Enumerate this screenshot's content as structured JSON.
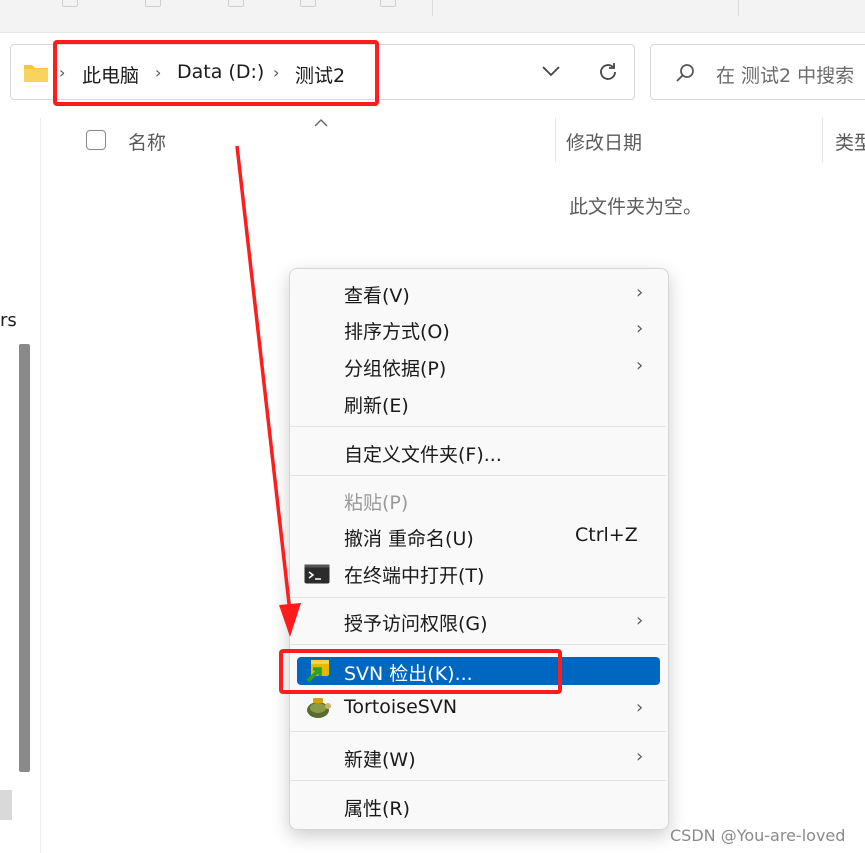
{
  "breadcrumb": {
    "items": [
      "此电脑",
      "Data (D:)",
      "测试2"
    ]
  },
  "search": {
    "placeholder": "在 测试2 中搜索"
  },
  "columns": {
    "name": "名称",
    "modified": "修改日期",
    "type": "类型"
  },
  "empty_message": "此文件夹为空。",
  "nav_fragment": "rs",
  "context_menu": {
    "items": [
      {
        "label": "查看(V)",
        "submenu": true
      },
      {
        "label": "排序方式(O)",
        "submenu": true
      },
      {
        "label": "分组依据(P)",
        "submenu": true
      },
      {
        "label": "刷新(E)"
      },
      {
        "label": "自定义文件夹(F)..."
      },
      {
        "label": "粘贴(P)",
        "disabled": true
      },
      {
        "label": "撤消 重命名(U)",
        "shortcut": "Ctrl+Z"
      },
      {
        "label": "在终端中打开(T)",
        "icon": "terminal-icon"
      },
      {
        "label": "授予访问权限(G)",
        "submenu": true
      },
      {
        "label": "SVN 检出(K)...",
        "icon": "svn-checkout-icon",
        "highlighted": true
      },
      {
        "label": "TortoiseSVN",
        "icon": "tortoisesvn-icon",
        "submenu": true
      },
      {
        "label": "新建(W)",
        "submenu": true
      },
      {
        "label": "属性(R)"
      }
    ]
  },
  "annotation": {
    "color": "#ff1c1c"
  },
  "colors": {
    "highlight": "#0067c0"
  },
  "watermark": "CSDN @You-are-loved"
}
